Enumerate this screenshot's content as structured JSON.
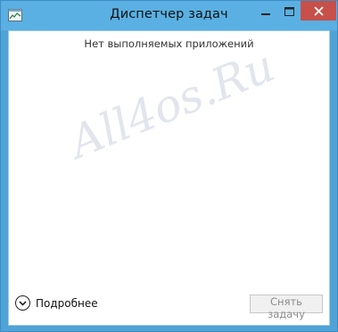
{
  "window": {
    "title": "Диспетчер задач",
    "icon": "task-manager-icon"
  },
  "caption_buttons": {
    "minimize_icon": "minimize-icon",
    "maximize_icon": "maximize-icon",
    "close_icon": "close-icon"
  },
  "main": {
    "empty_message": "Нет выполняемых приложений",
    "watermark": "All4os.Ru"
  },
  "footer": {
    "details_label": "Подробнее",
    "details_icon": "chevron-down-circle-icon",
    "end_task_label": "Снять задачу",
    "end_task_enabled": false
  },
  "colors": {
    "frame": "#5ab0e2",
    "close_button": "#c7504a",
    "client_background": "#ffffff"
  }
}
